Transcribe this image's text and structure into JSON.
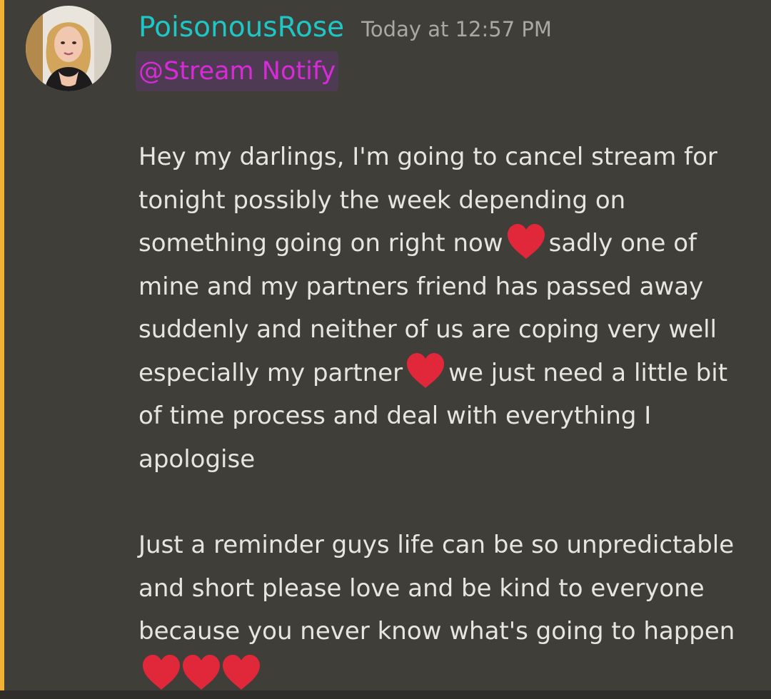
{
  "message": {
    "username": "PoisonousRose",
    "timestamp": "Today at 12:57 PM",
    "mention": "@Stream Notify",
    "avatar_icon": "user-avatar-photo",
    "accent_colors": {
      "username": "#1fc6c6",
      "mention": "#d82bd8",
      "mention_bar": "#f0b232",
      "heart": "#e1283b"
    },
    "paragraph1": {
      "seg1": "Hey my darlings, I'm going to cancel stream for tonight possibly the week depending on something going on right now",
      "seg2": "sadly one of mine and my partners friend has passed away suddenly and neither of us are coping very well especially my partner",
      "seg3": "we just need a little bit of time process and deal with everything I apologise"
    },
    "paragraph2": {
      "seg1": "Just a reminder guys life can be so unpredictable and short please love and be kind  to everyone because you never know what's going to happen"
    },
    "emoji_name": "red-heart-emoji"
  }
}
